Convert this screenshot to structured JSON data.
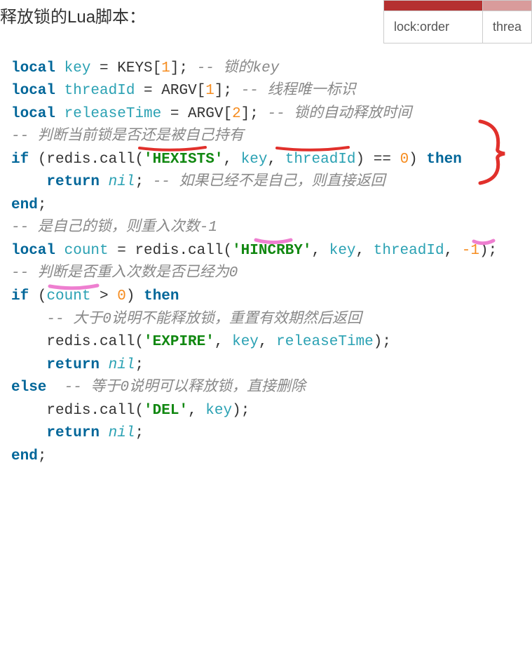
{
  "title": "释放锁的Lua脚本：",
  "table": {
    "cell_a": "lock:order",
    "cell_b": "threa"
  },
  "code": {
    "l1": {
      "kw": "local",
      "id": "key",
      "eq": " = KEYS[",
      "n": "1",
      "close": "]; ",
      "cmt": "-- 锁的key"
    },
    "l2": {
      "kw": "local",
      "id": "threadId",
      "eq": " = ARGV[",
      "n": "1",
      "close": "]; ",
      "cmt": "-- 线程唯一标识"
    },
    "l3": {
      "kw": "local",
      "id": "releaseTime",
      "eq": " = ARGV[",
      "n": "2",
      "close": "]; ",
      "cmt": "-- 锁的自动释放时间"
    },
    "l4": {
      "cmt": "-- 判断当前锁是否还是被自己持有"
    },
    "l5": {
      "kw": "if",
      "open": " (redis.call(",
      "s": "'HEXISTS'",
      "c1": ", ",
      "a1": "key",
      "c2": ", ",
      "a2": "threadId",
      "close": ") == ",
      "n": "0",
      "close2": ") ",
      "kw2": "then"
    },
    "l6": {
      "kw": "return",
      "sp": " ",
      "nil": "nil",
      "semi": "; ",
      "cmt": "-- 如果已经不是自己，则直接返回"
    },
    "l7": {
      "kw": "end",
      "semi": ";"
    },
    "l8": {
      "cmt": "-- 是自己的锁，则重入次数-1"
    },
    "l9": {
      "kw": "local",
      "id": "count",
      "eq": " = redis.call(",
      "s": "'HINCRBY'",
      "c1": ", ",
      "a1": "key",
      "c2": ", ",
      "a2": "threadId",
      "c3": ", ",
      "n": "-1",
      "close": ");"
    },
    "l10": {
      "cmt": "-- 判断是否重入次数是否已经为0"
    },
    "l11": {
      "kw": "if",
      "open": " (",
      "id": "count",
      "gt": " > ",
      "n": "0",
      "close": ") ",
      "kw2": "then"
    },
    "l12": {
      "cmt": "-- 大于0说明不能释放锁，重置有效期然后返回"
    },
    "l13": {
      "call": "redis.call(",
      "s": "'EXPIRE'",
      "c1": ", ",
      "a1": "key",
      "c2": ", ",
      "a2": "releaseTime",
      "close": ");"
    },
    "l14": {
      "kw": "return",
      "sp": " ",
      "nil": "nil",
      "semi": ";"
    },
    "l15": {
      "kw": "else",
      "sp": "  ",
      "cmt": "-- 等于0说明可以释放锁，直接删除"
    },
    "l16": {
      "call": "redis.call(",
      "s": "'DEL'",
      "c1": ", ",
      "a1": "key",
      "close": ");"
    },
    "l17": {
      "kw": "return",
      "sp": " ",
      "nil": "nil",
      "semi": ";"
    },
    "l18": {
      "kw": "end",
      "semi": ";"
    }
  }
}
